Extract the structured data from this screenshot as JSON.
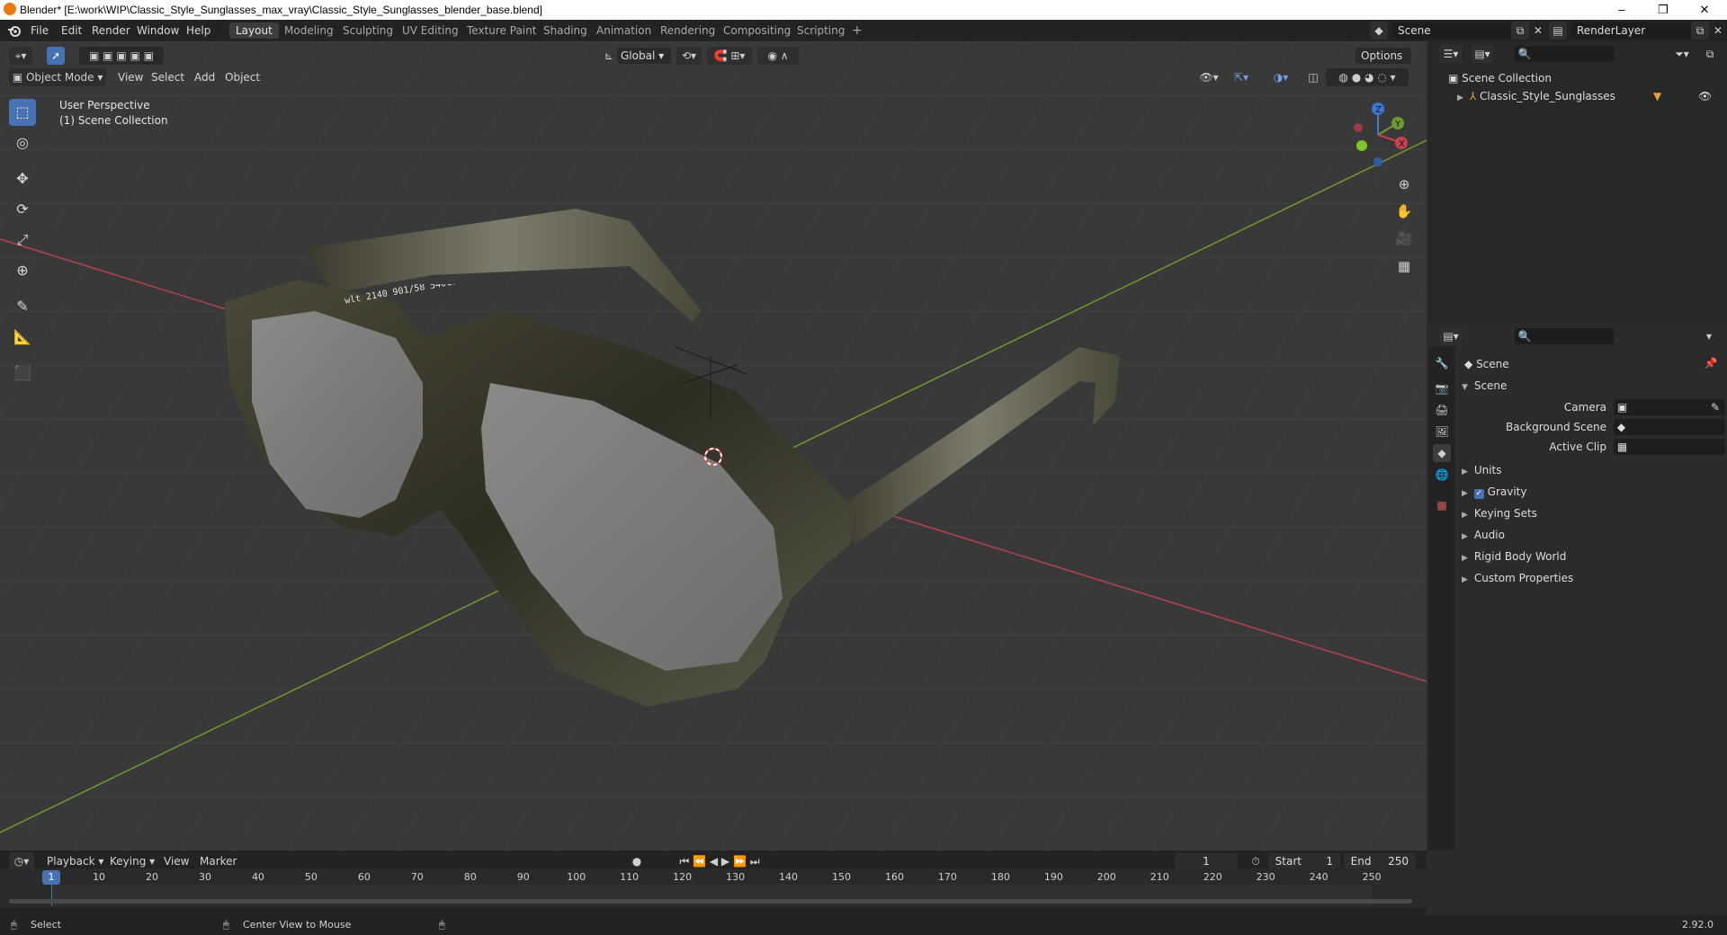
{
  "window": {
    "title": "Blender* [E:\\work\\WIP\\Classic_Style_Sunglasses_max_vray\\Classic_Style_Sunglasses_blender_base.blend]",
    "minimize": "–",
    "maximize": "❐",
    "close": "✕"
  },
  "menu": [
    "File",
    "Edit",
    "Render",
    "Window",
    "Help"
  ],
  "workspaces": [
    "Layout",
    "Modeling",
    "Sculpting",
    "UV Editing",
    "Texture Paint",
    "Shading",
    "Animation",
    "Rendering",
    "Compositing",
    "Scripting"
  ],
  "add_workspace": "+",
  "scene_field": "Scene",
  "renderlayer_field": "RenderLayer",
  "viewport": {
    "transform_orientation": "Global",
    "options": "Options",
    "mode": "Object Mode",
    "menus": [
      "View",
      "Select",
      "Add",
      "Object"
    ],
    "overlay_line1": "User Perspective",
    "overlay_line2": "(1) Scene Collection",
    "gizmo": {
      "z": "Z",
      "y": "Y",
      "x": "X"
    },
    "frame_text": "wlt 2140   901/58 54018 3P"
  },
  "outliner": {
    "root": "Scene Collection",
    "items": [
      {
        "label": "Classic_Style_Sunglasses"
      }
    ]
  },
  "properties": {
    "context": "Scene",
    "panel": "Scene",
    "fields": [
      {
        "label": "Camera",
        "value": ""
      },
      {
        "label": "Background Scene",
        "value": ""
      },
      {
        "label": "Active Clip",
        "value": ""
      }
    ],
    "subpanels": [
      {
        "label": "Units",
        "checkbox": false
      },
      {
        "label": "Gravity",
        "checkbox": true
      },
      {
        "label": "Keying Sets",
        "checkbox": false
      },
      {
        "label": "Audio",
        "checkbox": false
      },
      {
        "label": "Rigid Body World",
        "checkbox": false
      },
      {
        "label": "Custom Properties",
        "checkbox": false
      }
    ]
  },
  "timeline": {
    "menus": [
      "Playback",
      "Keying",
      "View",
      "Marker"
    ],
    "current_frame": "1",
    "start_label": "Start",
    "start_value": "1",
    "end_label": "End",
    "end_value": "250",
    "ticks": [
      "1",
      "10",
      "20",
      "30",
      "40",
      "50",
      "60",
      "70",
      "80",
      "90",
      "100",
      "110",
      "120",
      "130",
      "140",
      "150",
      "160",
      "170",
      "180",
      "190",
      "200",
      "210",
      "220",
      "230",
      "240",
      "250"
    ]
  },
  "status": {
    "left": "Select",
    "middle": "Center View to Mouse",
    "version": "2.92.0"
  },
  "colors": {
    "accent": "#4772b3",
    "x_axis": "#b4444f",
    "y_axis": "#6e9a2e",
    "frame_marker": "#4772b3"
  }
}
